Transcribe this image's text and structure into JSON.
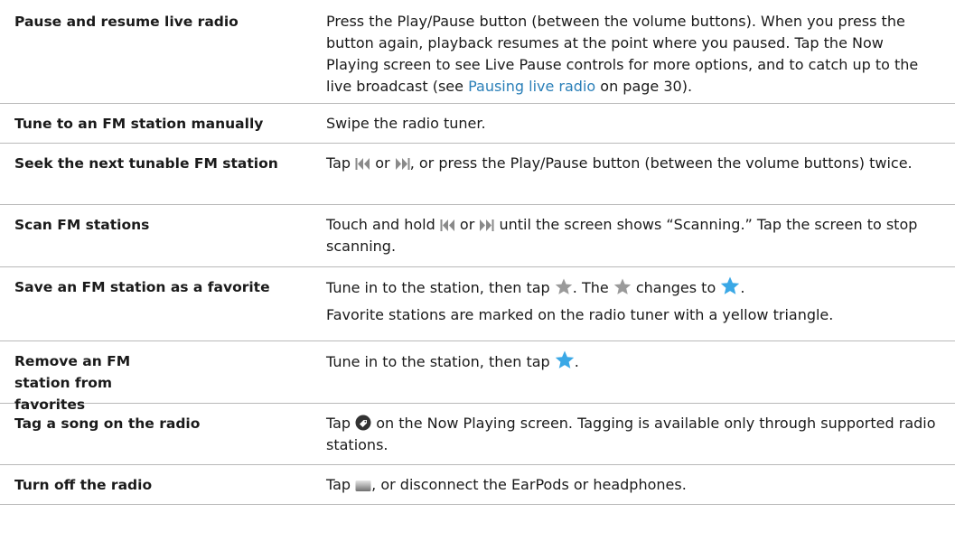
{
  "colors": {
    "text": "#1a1a1a",
    "link": "#2a7fb8",
    "rule": "#b9b9b9",
    "icon_gray": "#8a8a8a",
    "star_blue": "#3aa8e6",
    "tag_dark": "#333333"
  },
  "rows": [
    {
      "task": "Pause and resume live radio",
      "desc": {
        "t1": "Press the Play/Pause button (between the volume buttons). When you press the button again, playback resumes at the point where you paused. Tap the Now Playing screen to see Live Pause controls for more options, and to catch up to the live broadcast (see ",
        "link": "Pausing live radio",
        "t2": " on page 30)."
      }
    },
    {
      "task": "Tune to an FM station manually",
      "desc": {
        "t1": "Swipe the radio tuner."
      }
    },
    {
      "task": "Seek the next tunable FM station",
      "desc": {
        "t1": "Tap ",
        "t2": " or ",
        "t3": ", or press the Play/Pause button (between the volume buttons) twice."
      }
    },
    {
      "task": "Scan FM stations",
      "desc": {
        "t1": "Touch and hold ",
        "t2": " or ",
        "t3": " until the screen shows “Scanning.” Tap the screen to stop scanning."
      }
    },
    {
      "task": "Save an FM station as a favorite",
      "desc": {
        "t1": "Tune in to the station, then tap ",
        "t2": ". The ",
        "t3": " changes to ",
        "t4": ".",
        "p2": "Favorite stations are marked on the radio tuner with a yellow triangle."
      }
    },
    {
      "task": "Remove an FM station from favorites",
      "desc": {
        "t1": "Tune in to the station, then tap ",
        "t2": "."
      }
    },
    {
      "task": "Tag a song on the radio",
      "desc": {
        "t1": "Tap ",
        "t2": " on the Now Playing screen. Tagging is available only through supported radio stations."
      }
    },
    {
      "task": "Turn off the radio",
      "desc": {
        "t1": "Tap ",
        "t2": ", or disconnect the EarPods or headphones."
      }
    }
  ],
  "icons": {
    "previous": "previous-track-icon",
    "next": "next-track-icon",
    "star_gray": "favorite-star-outline-icon",
    "star_blue": "favorite-star-filled-icon",
    "tag": "tag-icon",
    "off": "radio-off-icon"
  }
}
